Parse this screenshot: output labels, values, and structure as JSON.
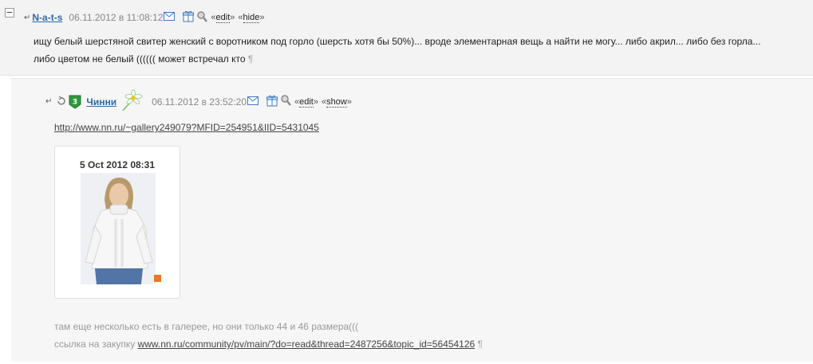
{
  "post1": {
    "collapse_symbol": "−",
    "reply_arrow": "↵",
    "username": "N-a-t-s",
    "timestamp": "06.11.2012 в 11:08:12",
    "edit_prefix": "«",
    "edit_label": "edit",
    "edit_suffix": "»",
    "hide_prefix": "«",
    "hide_label": "hide",
    "hide_suffix": "»",
    "text_line1": "ищу белый шерстяной свитер женский с воротником под горло (шерсть хотя бы 50%)... вроде элементарная вещь а найти не могу... либо акрил... либо без горла...",
    "text_line2": "либо цветом не белый (((((( может встречал кто",
    "pilcrow": "¶"
  },
  "post2": {
    "reply_arrow": "↵",
    "badge_number": "3",
    "username": "Чинни",
    "timestamp": "06.11.2012 в 23:52:20",
    "edit_prefix": "«",
    "edit_label": "edit",
    "edit_suffix": "»",
    "show_prefix": "«",
    "show_label": "show",
    "show_suffix": "»",
    "link_url": "http://www.nn.ru/~gallery249079?MFID=254951&IID=5431045",
    "card_date": "5 Oct 2012 08:31",
    "photo_caption": "",
    "text_line1": "там еще несколько есть в галерее, но они только 44 и 46 размера(((",
    "text_line2_prefix": "ссылка на закупку ",
    "text_line2_link": "www.nn.ru/community/pv/main/?do=read&thread=2487256&topic_id=56454126",
    "pilcrow": "¶"
  },
  "colors": {
    "username": "#2d6aa8",
    "badge_green": "#2e9a3c",
    "mail_blue": "#3a7bbf"
  },
  "icons": [
    "collapse-toggle",
    "reply-arrow-icon",
    "mail-icon",
    "gift-icon",
    "magnifier-icon",
    "badge-icon",
    "flower-icon"
  ]
}
